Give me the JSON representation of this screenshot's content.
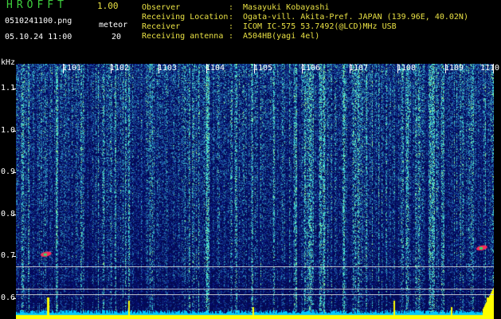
{
  "header": {
    "app_name": "HROFFT",
    "app_version": "1.00",
    "filename": "0510241100.png",
    "timestamp": "05.10.24 11:00",
    "meteor_label": "meteor",
    "meteor_count": "20"
  },
  "info": [
    {
      "key": "Observer",
      "value": "Masayuki Kobayashi"
    },
    {
      "key": "Receiving Location",
      "value": "Ogata-vill. Akita-Pref. JAPAN (139.96E, 40.02N)"
    },
    {
      "key": "Receiver",
      "value": "ICOM IC-575 53.7492(@LCD)MHz USB"
    },
    {
      "key": "Receiving antenna",
      "value": "A504HB(yagi 4el)"
    }
  ],
  "colors": {
    "background": "#000000",
    "header_text": "#e8e044",
    "app_name": "#3dcf3d",
    "spectrum_low": "#0a1a8a",
    "spectrum_high": "#46e0d6",
    "echo": "#ff2a5a",
    "baseline_trace": "#ffff00",
    "floor_trace": "#00c8ff"
  },
  "chart_data": {
    "type": "heatmap",
    "xlabel": "",
    "ylabel": "kHz",
    "time_ticks": [
      "1101",
      "1102",
      "1103",
      "1104",
      "1105",
      "1106",
      "1107",
      "1108",
      "1109",
      "1110"
    ],
    "freq_ticks": [
      "1.1",
      "1.0",
      "0.9",
      "0.8",
      "0.7",
      "0.6"
    ],
    "freq_tick_values": [
      1.1,
      1.0,
      0.9,
      0.8,
      0.7,
      0.6
    ],
    "time_tick_minutes": [
      1,
      2,
      3,
      4,
      5,
      6,
      7,
      8,
      9,
      10
    ],
    "time_range_minutes": [
      0,
      10
    ],
    "freq_range_khz": [
      0.55,
      1.16
    ],
    "reference_lines_khz": [
      0.675,
      0.622,
      0.61
    ],
    "meteor_echoes": [
      {
        "minute": 0.63,
        "freq_khz": 0.705
      },
      {
        "minute": 9.75,
        "freq_khz": 0.72
      }
    ],
    "bottom_spikes_minutes": [
      0.65,
      2.35,
      4.95,
      7.9,
      9.1,
      9.85
    ]
  }
}
